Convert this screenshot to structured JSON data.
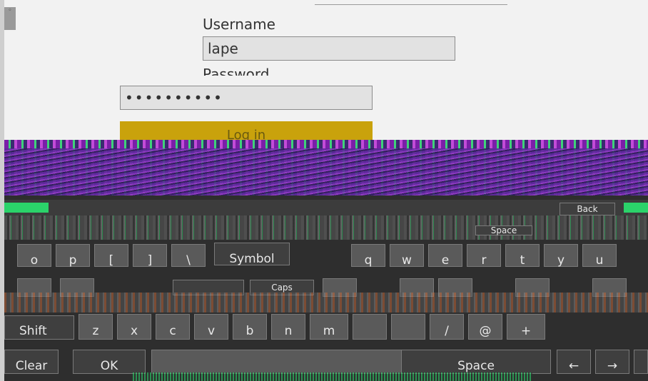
{
  "login": {
    "username_label": "Username",
    "username_value": "lape",
    "password_label": "Password",
    "password_value": "••••••••••",
    "login_label": "Log in"
  },
  "keyboard": {
    "back_label": "Back",
    "space_small_label": "Space",
    "row1": [
      "o",
      "p",
      "[",
      "]",
      "\\",
      "Symbol",
      "q",
      "w",
      "e",
      "r",
      "t",
      "y",
      "u"
    ],
    "caps_label": "Caps",
    "row3": [
      "Shift",
      "z",
      "x",
      "c",
      "v",
      "b",
      "n",
      "m",
      "/",
      "@",
      "+"
    ],
    "row4": [
      "Clear",
      "OK",
      "Space",
      "←",
      "→"
    ]
  }
}
